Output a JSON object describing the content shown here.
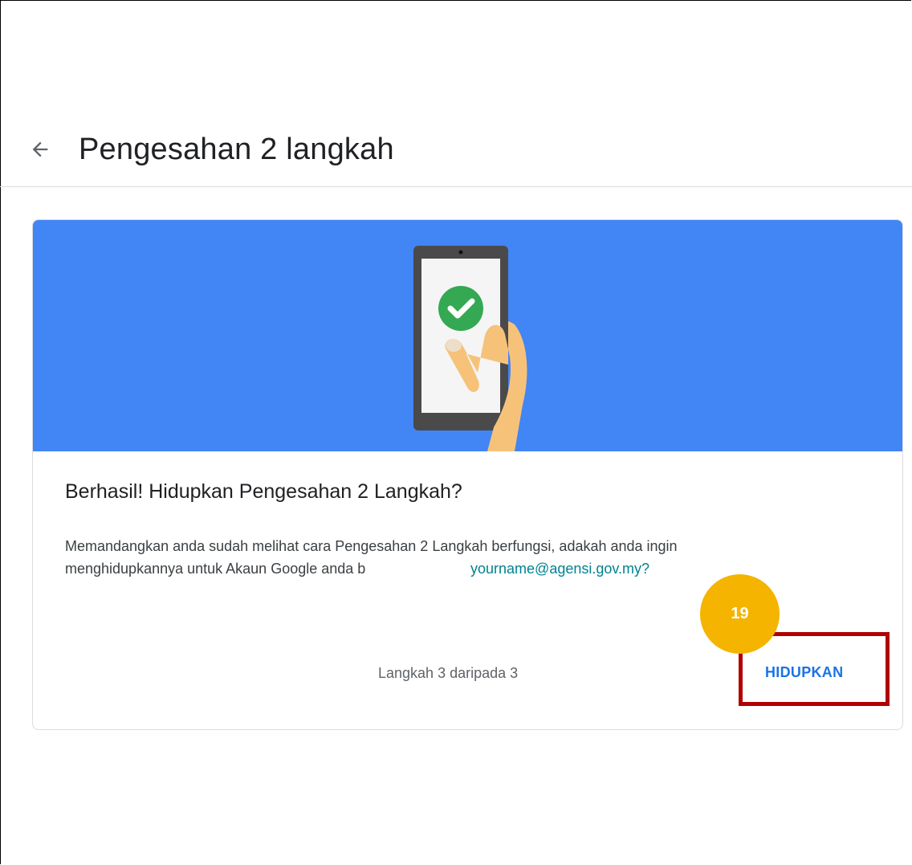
{
  "header": {
    "back_icon": "arrow-left-icon",
    "title": "Pengesahan 2 langkah"
  },
  "card": {
    "illustration_icon": "phone-checkmark-illustration",
    "title": "Berhasil! Hidupkan Pengesahan 2 Langkah?",
    "description_line1": "Memandangkan anda sudah melihat cara Pengesahan 2 Langkah berfungsi, adakah anda ingin",
    "description_line2": "menghidupkannya untuk Akaun Google anda b",
    "email": "yourname@agensi.gov.my?",
    "step_text": "Langkah 3 daripada 3",
    "turn_on_label": "HIDUPKAN"
  },
  "annotation": {
    "badge_number": "19"
  },
  "colors": {
    "banner": "#4285f4",
    "accent": "#1a73e8",
    "check": "#34a853",
    "badge": "#f4b400",
    "highlight": "#b10000",
    "email": "#00838f"
  }
}
